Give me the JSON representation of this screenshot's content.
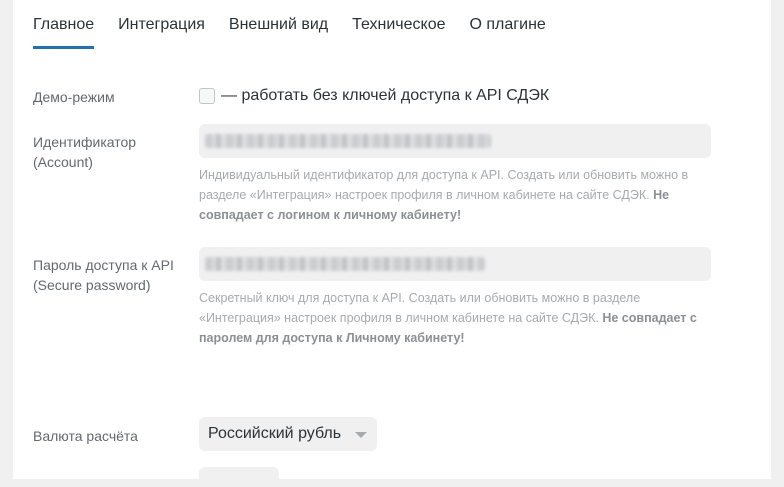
{
  "tabs": [
    {
      "label": "Главное",
      "active": true
    },
    {
      "label": "Интеграция",
      "active": false
    },
    {
      "label": "Внешний вид",
      "active": false
    },
    {
      "label": "Техническое",
      "active": false
    },
    {
      "label": "О плагине",
      "active": false
    }
  ],
  "demo": {
    "label": "Демо-режим",
    "checkbox_text": "— работать без ключей доступа к API СДЭК",
    "checked": false
  },
  "account": {
    "label_line1": "Идентификатор",
    "label_line2": "(Account)",
    "desc_plain": "Индивидуальный идентификатор для доступа к API. Создать или обновить можно в разделе «Интеграция» настроек профиля в личном кабинете на сайте СДЭК.",
    "desc_bold": "Не совпадает с логином к личному кабинету!"
  },
  "password": {
    "label_line1": "Пароль доступа к API",
    "label_line2": "(Secure password)",
    "desc_plain": "Секретный ключ для доступа к API. Создать или обновить можно в разделе «Интеграция» настроек профиля в личном кабинете на сайте СДЭК.",
    "desc_bold": "Не совпадает с паролем для доступа к Личному кабинету!"
  },
  "currency": {
    "label": "Валюта расчёта",
    "selected": "Российский рубль"
  },
  "colors": {
    "accent": "#2271b1",
    "field_bg": "#f0f0f1",
    "text": "#2c3338",
    "muted": "#646970"
  }
}
